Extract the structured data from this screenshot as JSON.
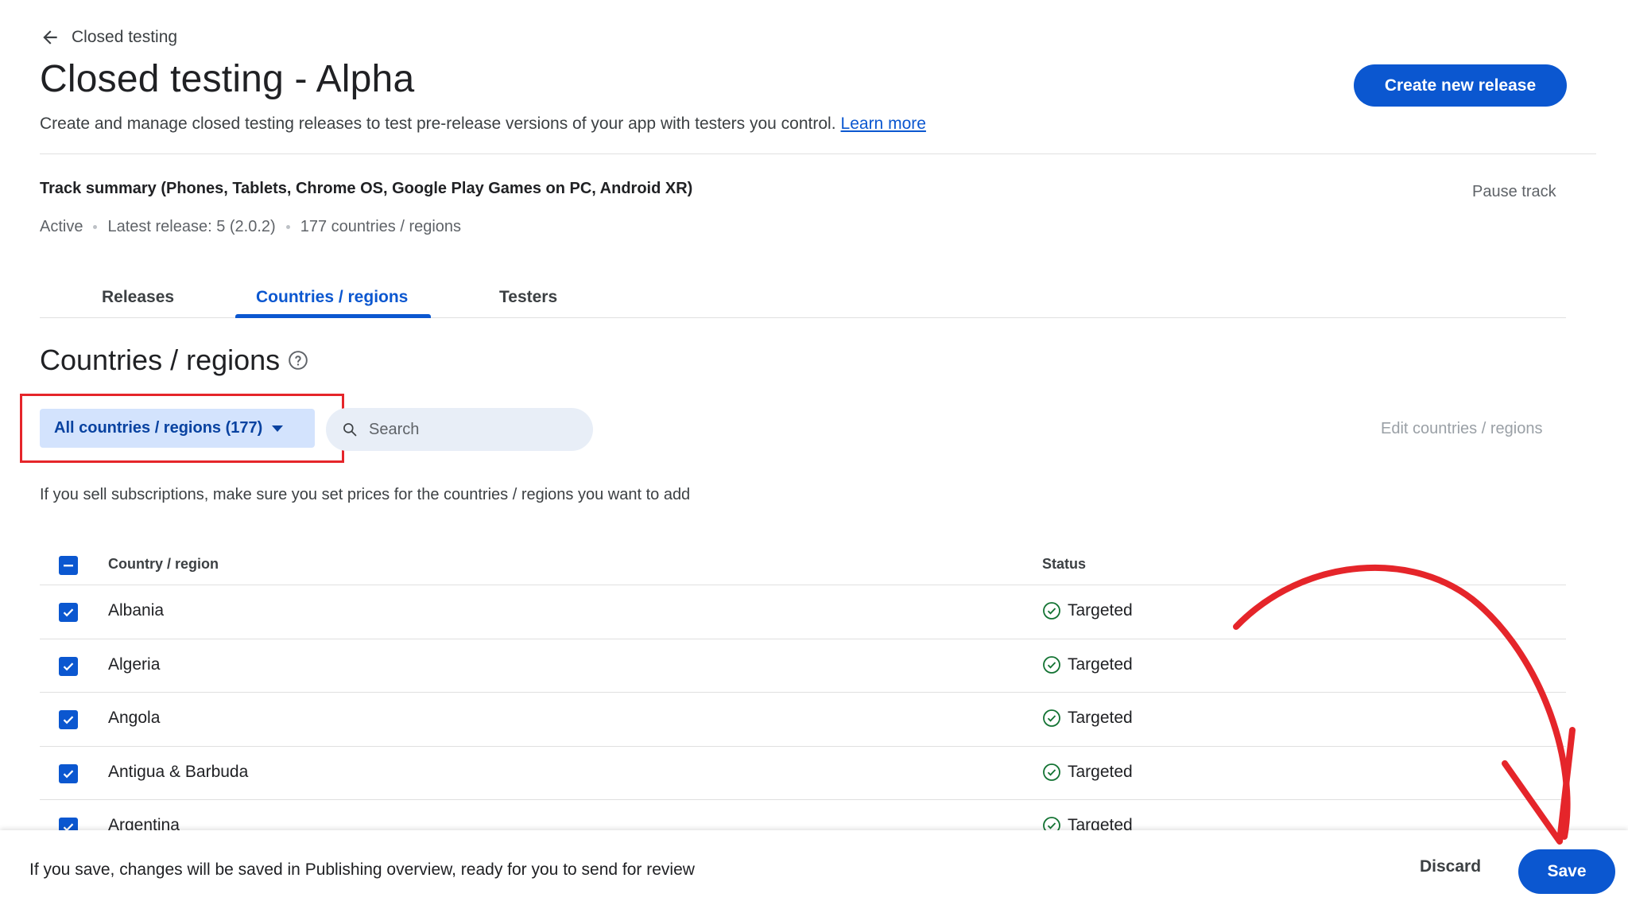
{
  "breadcrumb": {
    "label": "Closed testing",
    "icon": "arrow-back-icon"
  },
  "header": {
    "title": "Closed testing - Alpha",
    "subtitle": "Create and manage closed testing releases to test pre-release versions of your app with testers you control.",
    "learn_more": "Learn more",
    "create_release_label": "Create new release"
  },
  "track": {
    "summary": "Track summary (Phones, Tablets, Chrome OS, Google Play Games on PC, Android XR)",
    "pause_label": "Pause track",
    "status": "Active",
    "latest_release": "Latest release: 5 (2.0.2)",
    "countries_count": "177 countries / regions"
  },
  "tabs": [
    {
      "label": "Releases",
      "active": false
    },
    {
      "label": "Countries / regions",
      "active": true
    },
    {
      "label": "Testers",
      "active": false
    }
  ],
  "section": {
    "title": "Countries / regions",
    "filter_label": "All countries / regions (177)",
    "search_placeholder": "Search",
    "edit_label": "Edit countries / regions",
    "notice": "If you sell subscriptions, make sure you set prices for the countries / regions you want to add"
  },
  "table": {
    "headers": {
      "country": "Country / region",
      "status": "Status"
    },
    "rows": [
      {
        "country": "Albania",
        "status": "Targeted"
      },
      {
        "country": "Algeria",
        "status": "Targeted"
      },
      {
        "country": "Angola",
        "status": "Targeted"
      },
      {
        "country": "Antigua & Barbuda",
        "status": "Targeted"
      },
      {
        "country": "Argentina",
        "status": "Targeted"
      }
    ]
  },
  "footer": {
    "text": "If you save, changes will be saved in Publishing overview, ready for you to send for review",
    "discard_label": "Discard",
    "save_label": "Save"
  },
  "colors": {
    "primary": "#0b57d0",
    "filter_bg": "#d3e3fd",
    "targeted_green": "#137333",
    "annotation_red": "#e5252a"
  }
}
